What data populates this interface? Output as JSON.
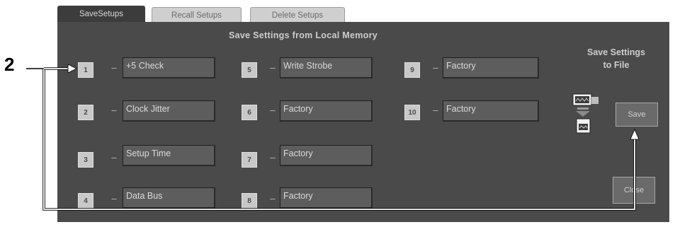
{
  "callout": {
    "number": "2"
  },
  "tabs": [
    {
      "label": "SaveSetups",
      "active": true
    },
    {
      "label": "Recall Setups",
      "active": false
    },
    {
      "label": "Delete Setups",
      "active": false
    }
  ],
  "panel": {
    "title": "Save Settings from Local Memory",
    "slots": [
      {
        "num": "1",
        "name": "+5 Check"
      },
      {
        "num": "2",
        "name": "Clock Jitter"
      },
      {
        "num": "3",
        "name": "Setup Time"
      },
      {
        "num": "4",
        "name": "Data Bus"
      },
      {
        "num": "5",
        "name": "Write Strobe"
      },
      {
        "num": "6",
        "name": "Factory"
      },
      {
        "num": "7",
        "name": "Factory"
      },
      {
        "num": "8",
        "name": "Factory"
      },
      {
        "num": "9",
        "name": "Factory"
      },
      {
        "num": "10",
        "name": "Factory"
      }
    ],
    "dash": "–"
  },
  "side": {
    "title_line1": "Save Settings",
    "title_line2": "to File",
    "save_label": "Save",
    "close_label": "Close"
  },
  "colors": {
    "panel_bg": "#4a4a4a",
    "callout_line": "#ffffff",
    "callout_text": "#000000"
  }
}
